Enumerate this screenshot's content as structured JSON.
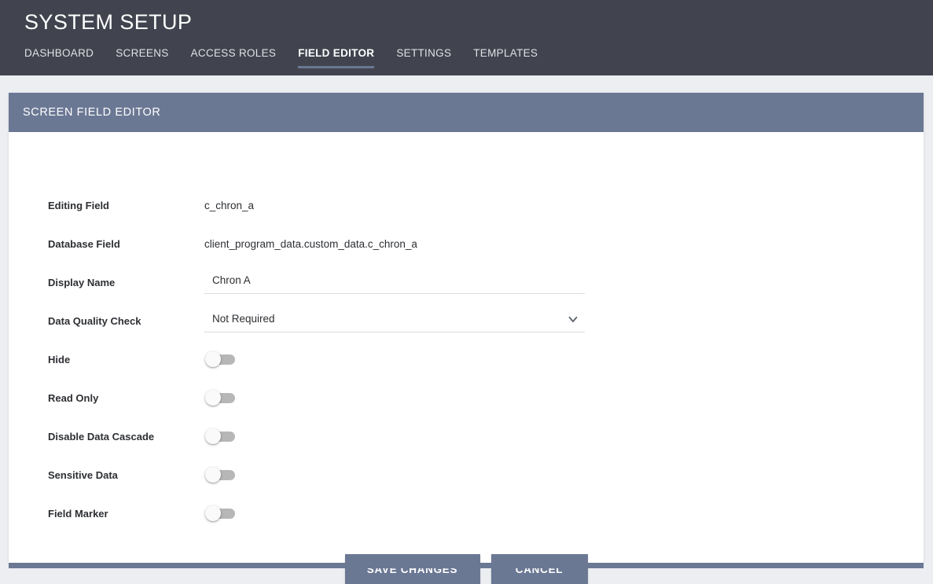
{
  "header": {
    "title": "SYSTEM SETUP",
    "tabs": [
      {
        "label": "DASHBOARD",
        "active": false
      },
      {
        "label": "SCREENS",
        "active": false
      },
      {
        "label": "ACCESS ROLES",
        "active": false
      },
      {
        "label": "FIELD EDITOR",
        "active": true
      },
      {
        "label": "SETTINGS",
        "active": false
      },
      {
        "label": "TEMPLATES",
        "active": false
      }
    ]
  },
  "card": {
    "header_title": "SCREEN FIELD EDITOR",
    "fields": {
      "editing_field": {
        "label": "Editing Field",
        "value": "c_chron_a"
      },
      "database_field": {
        "label": "Database Field",
        "value": "client_program_data.custom_data.c_chron_a"
      },
      "display_name": {
        "label": "Display Name",
        "value": "Chron A",
        "placeholder": ""
      },
      "data_quality_check": {
        "label": "Data Quality Check",
        "value": "Not Required",
        "options": [
          "Not Required"
        ],
        "chevron_icon": "chevron-down-icon"
      }
    },
    "toggles": [
      {
        "label": "Hide",
        "state": "off"
      },
      {
        "label": "Read Only",
        "state": "off"
      },
      {
        "label": "Disable Data Cascade",
        "state": "off"
      },
      {
        "label": "Sensitive Data",
        "state": "off"
      },
      {
        "label": "Field Marker",
        "state": "off"
      }
    ],
    "buttons": {
      "save_label": "SAVE CHANGES",
      "cancel_label": "CANCEL"
    }
  },
  "colors": {
    "app_header_bg": "#41444e",
    "page_bg": "#eceef2",
    "accent_slate": "#6b7894",
    "card_bg": "#ffffff",
    "text_dark": "#2d2f33",
    "toggle_track_off": "#b7b7b7",
    "underline": "#dcdcdc"
  }
}
